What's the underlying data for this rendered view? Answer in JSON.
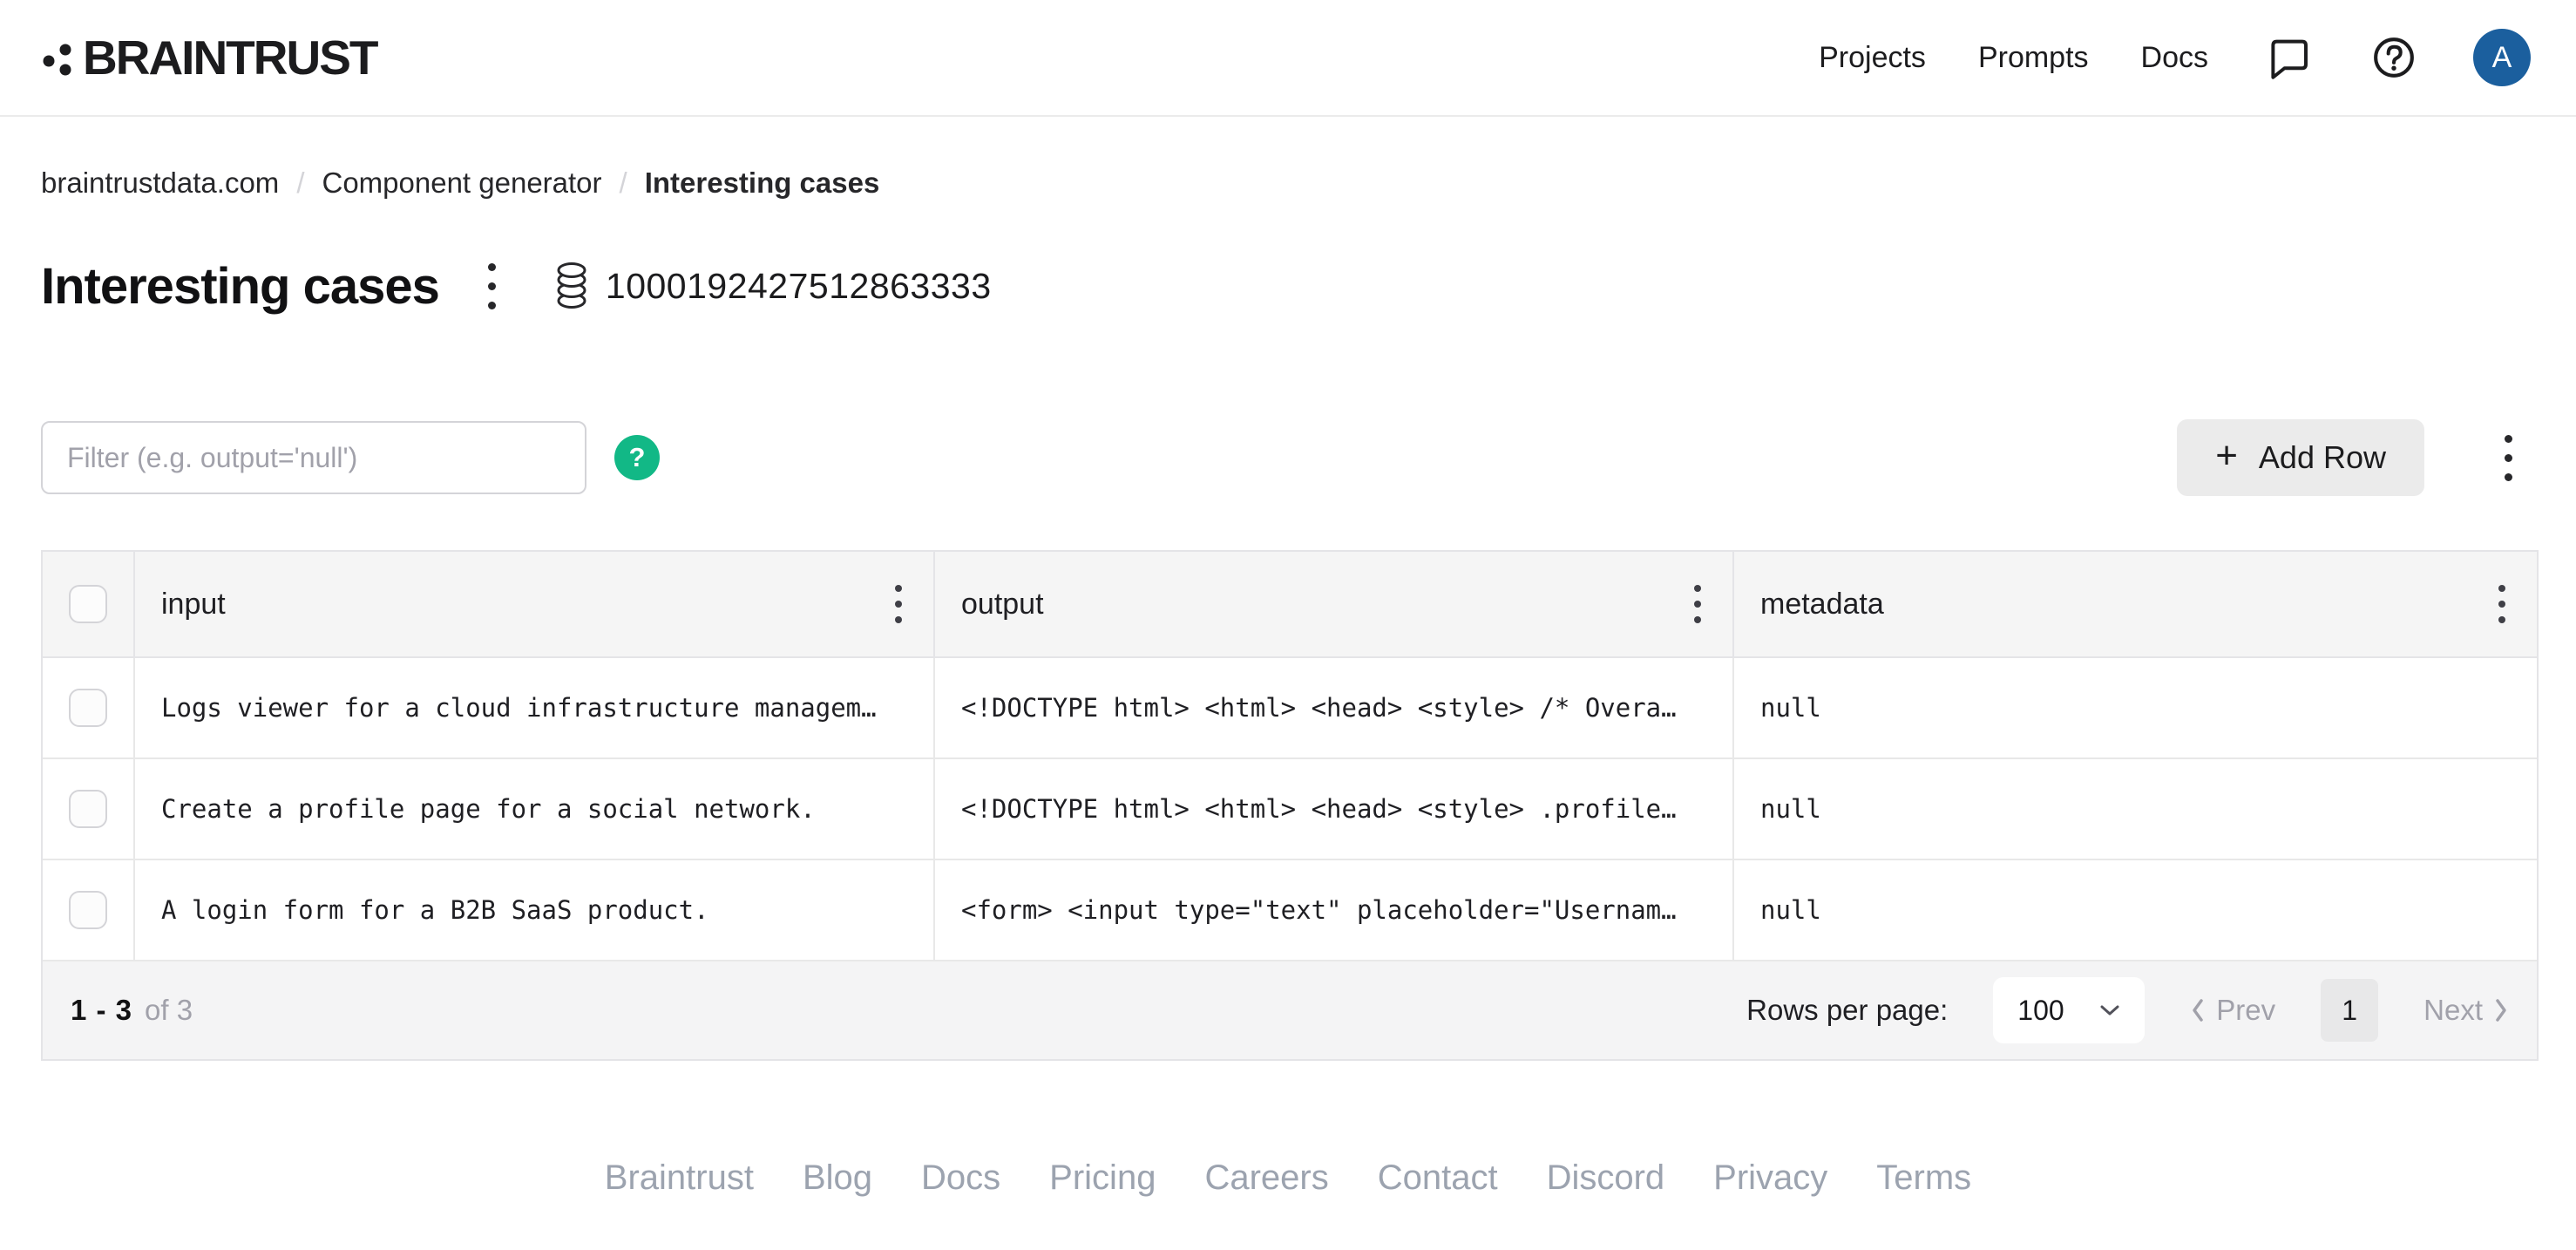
{
  "nav": {
    "logo_text": "BRAINTRUST",
    "links": [
      {
        "label": "Projects"
      },
      {
        "label": "Prompts"
      },
      {
        "label": "Docs"
      }
    ],
    "avatar_initial": "A"
  },
  "breadcrumb": {
    "separator": "/",
    "items": [
      "braintrustdata.com",
      "Component generator",
      "Interesting cases"
    ]
  },
  "page": {
    "title": "Interesting cases",
    "dataset_id": "1000192427512863333"
  },
  "toolbar": {
    "filter_placeholder": "Filter (e.g. output='null')",
    "help_glyph": "?",
    "plus": "+",
    "add_row_label": "Add Row"
  },
  "table": {
    "columns": [
      {
        "label": "input"
      },
      {
        "label": "output"
      },
      {
        "label": "metadata"
      }
    ],
    "rows": [
      {
        "input": "Logs viewer for a cloud infrastructure managem…",
        "output": "<!DOCTYPE html> <html> <head> <style> /* Overa…",
        "metadata": "null"
      },
      {
        "input": "Create a profile page for a social network.",
        "output": "<!DOCTYPE html> <html> <head> <style> .profile…",
        "metadata": "null"
      },
      {
        "input": "A login form for a B2B SaaS product.",
        "output": "<form> <input type=\"text\" placeholder=\"Usernam…",
        "metadata": "null"
      }
    ]
  },
  "pagination": {
    "range": "1 - 3",
    "of_total": "of 3",
    "rows_per_page_label": "Rows per page:",
    "rows_per_page_value": "100",
    "prev_label": "Prev",
    "page_number": "1",
    "next_label": "Next"
  },
  "footer": {
    "links": [
      "Braintrust",
      "Blog",
      "Docs",
      "Pricing",
      "Careers",
      "Contact",
      "Discord",
      "Privacy",
      "Terms"
    ]
  },
  "colors": {
    "avatar_bg": "#1b5f9e",
    "help_badge_bg": "#12b886"
  }
}
